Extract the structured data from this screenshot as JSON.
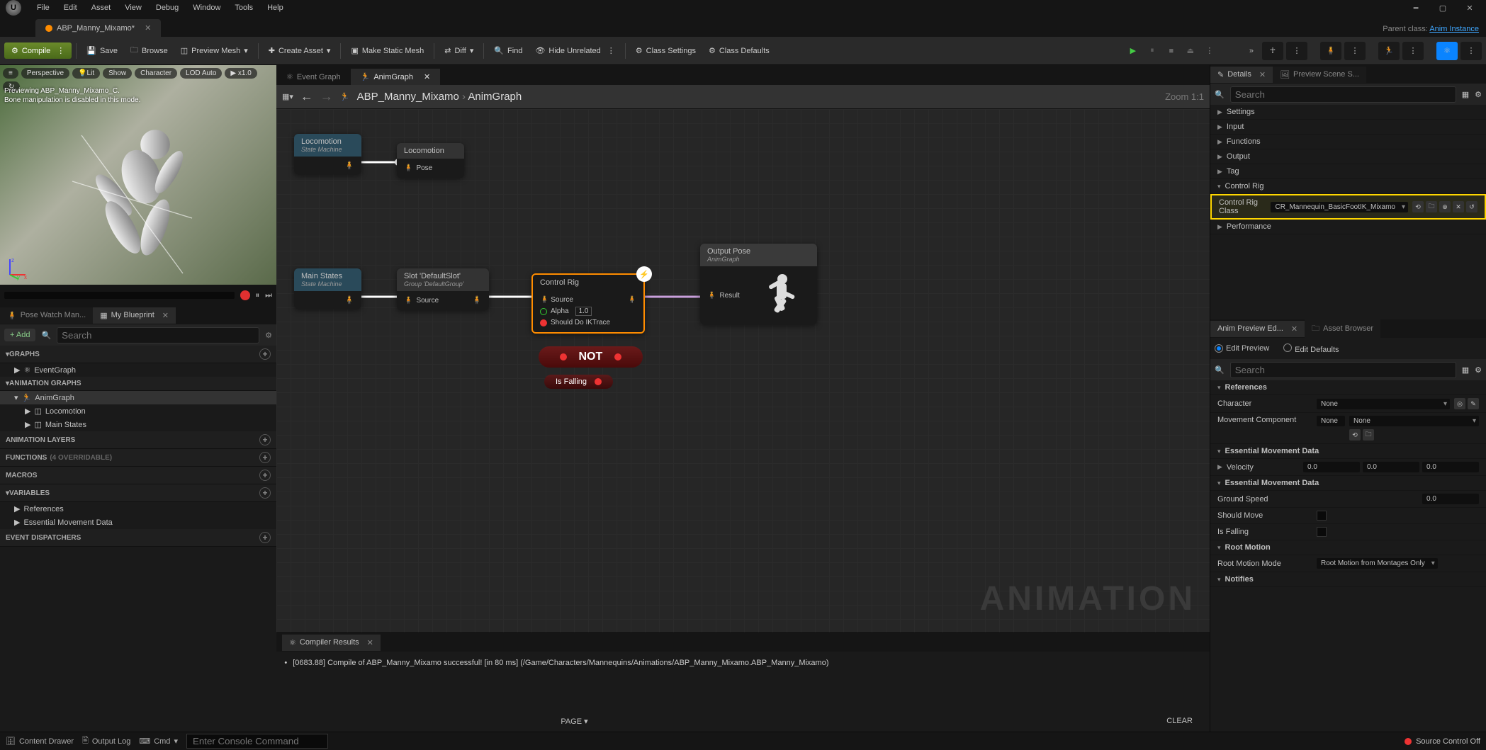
{
  "menu": [
    "File",
    "Edit",
    "Asset",
    "View",
    "Debug",
    "Window",
    "Tools",
    "Help"
  ],
  "docTab": "ABP_Manny_Mixamo*",
  "parentClass": {
    "label": "Parent class:",
    "link": "Anim Instance"
  },
  "toolbar": {
    "compile": "Compile",
    "save": "Save",
    "browse": "Browse",
    "previewMesh": "Preview Mesh",
    "createAsset": "Create Asset",
    "makeStatic": "Make Static Mesh",
    "diff": "Diff",
    "find": "Find",
    "hideUnrelated": "Hide Unrelated",
    "classSettings": "Class Settings",
    "classDefaults": "Class Defaults"
  },
  "viewport": {
    "buttons": [
      "Perspective",
      "Lit",
      "Show",
      "Character",
      "LOD Auto",
      "x1.0"
    ],
    "line1": "Previewing ABP_Manny_Mixamo_C.",
    "line2": "Bone manipulation is disabled in this mode."
  },
  "leftTabs": {
    "poseWatch": "Pose Watch Man...",
    "myBlueprint": "My Blueprint"
  },
  "addBtn": "Add",
  "searchPlaceholder": "Search",
  "categories": {
    "graphs": "GRAPHS",
    "animGraphs": "ANIMATION GRAPHS",
    "animLayers": "ANIMATION LAYERS",
    "functions": "FUNCTIONS",
    "functionsNote": "(4 OVERRIDABLE)",
    "macros": "MACROS",
    "variables": "VARIABLES",
    "eventDisp": "EVENT DISPATCHERS"
  },
  "tree": {
    "eventGraph": "EventGraph",
    "animGraph": "AnimGraph",
    "locomotion": "Locomotion",
    "mainStates": "Main States",
    "references": "References",
    "essentialMove": "Essential Movement Data"
  },
  "graphTabs": {
    "event": "Event Graph",
    "anim": "AnimGraph"
  },
  "breadcrumb": {
    "root": "ABP_Manny_Mixamo",
    "leaf": "AnimGraph"
  },
  "zoomLabel": "Zoom 1:1",
  "nodes": {
    "loco1": {
      "title": "Locomotion",
      "sub": "State Machine"
    },
    "loco2": {
      "title": "Locomotion",
      "pose": "Pose"
    },
    "mainStates": {
      "title": "Main States",
      "sub": "State Machine"
    },
    "slot": {
      "title": "Slot 'DefaultSlot'",
      "sub": "Group 'DefaultGroup'",
      "source": "Source"
    },
    "ctrlrig": {
      "title": "Control Rig",
      "source": "Source",
      "alpha": "Alpha",
      "alphaVal": "1.0",
      "iktrace": "Should Do IKTrace"
    },
    "output": {
      "title": "Output Pose",
      "sub": "AnimGraph",
      "result": "Result"
    },
    "not": "NOT",
    "isFalling": "Is Falling"
  },
  "watermark": "ANIMATION",
  "compiler": {
    "tab": "Compiler Results",
    "msg": "[0683.88] Compile of ABP_Manny_Mixamo successful! [in 80 ms] (/Game/Characters/Mannequins/Animations/ABP_Manny_Mixamo.ABP_Manny_Mixamo)",
    "page": "PAGE",
    "clear": "CLEAR"
  },
  "rightTabs": {
    "details": "Details",
    "previewScene": "Preview Scene S...",
    "animPrev": "Anim Preview Ed...",
    "assetBrowser": "Asset Browser"
  },
  "detailCats": [
    "Settings",
    "Input",
    "Functions",
    "Output",
    "Tag",
    "Control Rig",
    "Performance"
  ],
  "controlRigRow": {
    "label": "Control Rig Class",
    "value": "CR_Mannequin_BasicFootIK_Mixamo"
  },
  "editRadios": {
    "preview": "Edit Preview",
    "defaults": "Edit Defaults"
  },
  "previewProps": {
    "references": "References",
    "character": "Character",
    "charVal": "None",
    "moveComp": "Movement Component",
    "moveVal": "None",
    "moveVal2": "None",
    "essential1": "Essential Movement Data",
    "velocity": "Velocity",
    "vel": [
      "0.0",
      "0.0",
      "0.0"
    ],
    "essential2": "Essential Movement Data",
    "groundSpeed": "Ground Speed",
    "gsVal": "0.0",
    "shouldMove": "Should Move",
    "isFalling": "Is Falling",
    "rootMotion": "Root Motion",
    "rmMode": "Root Motion Mode",
    "rmVal": "Root Motion from Montages Only",
    "notifies": "Notifies"
  },
  "bottombar": {
    "contentDrawer": "Content Drawer",
    "outputLog": "Output Log",
    "cmd": "Cmd",
    "cmdPlaceholder": "Enter Console Command",
    "sourceControl": "Source Control Off"
  }
}
